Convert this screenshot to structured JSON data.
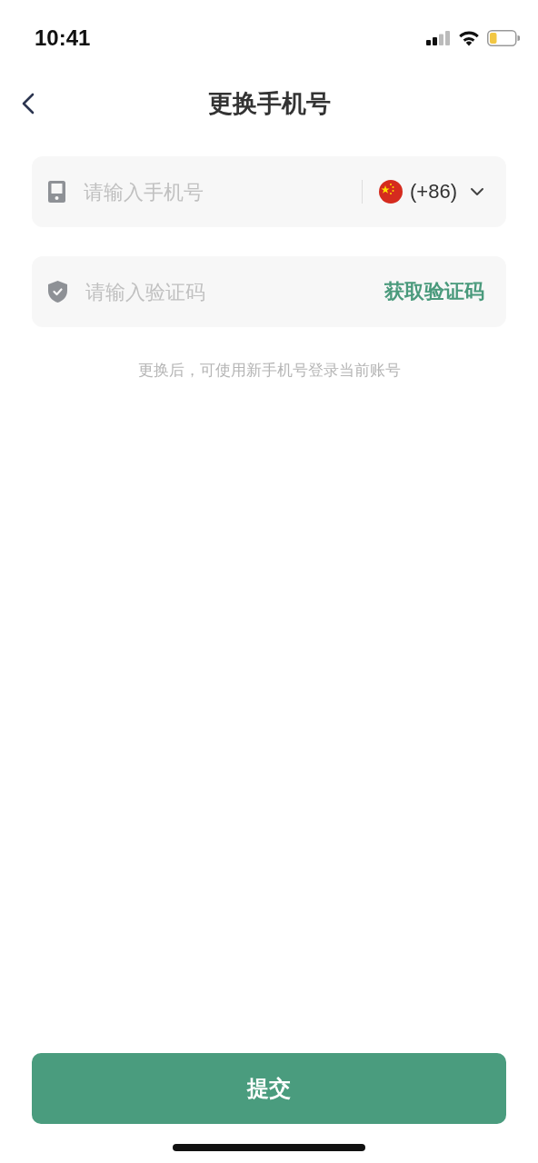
{
  "status_bar": {
    "time": "10:41"
  },
  "nav": {
    "title": "更换手机号"
  },
  "phone_field": {
    "placeholder": "请输入手机号",
    "country_code": "(+86)"
  },
  "code_field": {
    "placeholder": "请输入验证码",
    "action": "获取验证码"
  },
  "hint": "更换后，可使用新手机号登录当前账号",
  "submit": "提交"
}
